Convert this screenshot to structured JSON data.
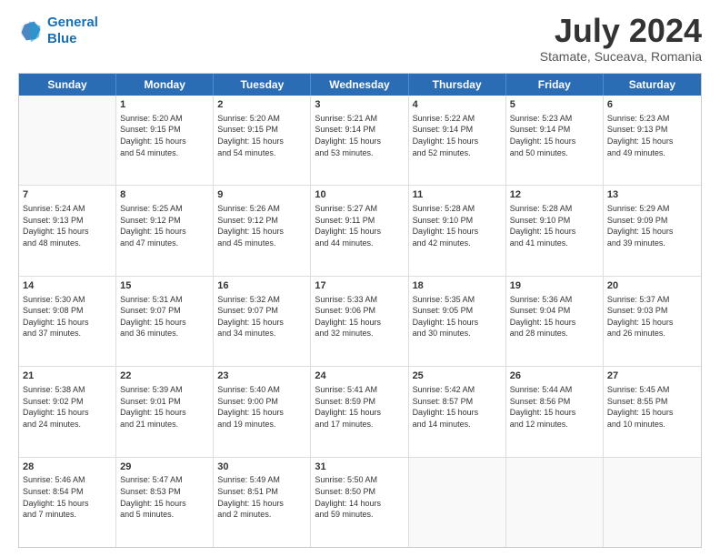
{
  "header": {
    "logo_line1": "General",
    "logo_line2": "Blue",
    "month_title": "July 2024",
    "location": "Stamate, Suceava, Romania"
  },
  "days_of_week": [
    "Sunday",
    "Monday",
    "Tuesday",
    "Wednesday",
    "Thursday",
    "Friday",
    "Saturday"
  ],
  "weeks": [
    [
      {
        "day": "",
        "content": ""
      },
      {
        "day": "1",
        "content": "Sunrise: 5:20 AM\nSunset: 9:15 PM\nDaylight: 15 hours\nand 54 minutes."
      },
      {
        "day": "2",
        "content": "Sunrise: 5:20 AM\nSunset: 9:15 PM\nDaylight: 15 hours\nand 54 minutes."
      },
      {
        "day": "3",
        "content": "Sunrise: 5:21 AM\nSunset: 9:14 PM\nDaylight: 15 hours\nand 53 minutes."
      },
      {
        "day": "4",
        "content": "Sunrise: 5:22 AM\nSunset: 9:14 PM\nDaylight: 15 hours\nand 52 minutes."
      },
      {
        "day": "5",
        "content": "Sunrise: 5:23 AM\nSunset: 9:14 PM\nDaylight: 15 hours\nand 50 minutes."
      },
      {
        "day": "6",
        "content": "Sunrise: 5:23 AM\nSunset: 9:13 PM\nDaylight: 15 hours\nand 49 minutes."
      }
    ],
    [
      {
        "day": "7",
        "content": "Sunrise: 5:24 AM\nSunset: 9:13 PM\nDaylight: 15 hours\nand 48 minutes."
      },
      {
        "day": "8",
        "content": "Sunrise: 5:25 AM\nSunset: 9:12 PM\nDaylight: 15 hours\nand 47 minutes."
      },
      {
        "day": "9",
        "content": "Sunrise: 5:26 AM\nSunset: 9:12 PM\nDaylight: 15 hours\nand 45 minutes."
      },
      {
        "day": "10",
        "content": "Sunrise: 5:27 AM\nSunset: 9:11 PM\nDaylight: 15 hours\nand 44 minutes."
      },
      {
        "day": "11",
        "content": "Sunrise: 5:28 AM\nSunset: 9:10 PM\nDaylight: 15 hours\nand 42 minutes."
      },
      {
        "day": "12",
        "content": "Sunrise: 5:28 AM\nSunset: 9:10 PM\nDaylight: 15 hours\nand 41 minutes."
      },
      {
        "day": "13",
        "content": "Sunrise: 5:29 AM\nSunset: 9:09 PM\nDaylight: 15 hours\nand 39 minutes."
      }
    ],
    [
      {
        "day": "14",
        "content": "Sunrise: 5:30 AM\nSunset: 9:08 PM\nDaylight: 15 hours\nand 37 minutes."
      },
      {
        "day": "15",
        "content": "Sunrise: 5:31 AM\nSunset: 9:07 PM\nDaylight: 15 hours\nand 36 minutes."
      },
      {
        "day": "16",
        "content": "Sunrise: 5:32 AM\nSunset: 9:07 PM\nDaylight: 15 hours\nand 34 minutes."
      },
      {
        "day": "17",
        "content": "Sunrise: 5:33 AM\nSunset: 9:06 PM\nDaylight: 15 hours\nand 32 minutes."
      },
      {
        "day": "18",
        "content": "Sunrise: 5:35 AM\nSunset: 9:05 PM\nDaylight: 15 hours\nand 30 minutes."
      },
      {
        "day": "19",
        "content": "Sunrise: 5:36 AM\nSunset: 9:04 PM\nDaylight: 15 hours\nand 28 minutes."
      },
      {
        "day": "20",
        "content": "Sunrise: 5:37 AM\nSunset: 9:03 PM\nDaylight: 15 hours\nand 26 minutes."
      }
    ],
    [
      {
        "day": "21",
        "content": "Sunrise: 5:38 AM\nSunset: 9:02 PM\nDaylight: 15 hours\nand 24 minutes."
      },
      {
        "day": "22",
        "content": "Sunrise: 5:39 AM\nSunset: 9:01 PM\nDaylight: 15 hours\nand 21 minutes."
      },
      {
        "day": "23",
        "content": "Sunrise: 5:40 AM\nSunset: 9:00 PM\nDaylight: 15 hours\nand 19 minutes."
      },
      {
        "day": "24",
        "content": "Sunrise: 5:41 AM\nSunset: 8:59 PM\nDaylight: 15 hours\nand 17 minutes."
      },
      {
        "day": "25",
        "content": "Sunrise: 5:42 AM\nSunset: 8:57 PM\nDaylight: 15 hours\nand 14 minutes."
      },
      {
        "day": "26",
        "content": "Sunrise: 5:44 AM\nSunset: 8:56 PM\nDaylight: 15 hours\nand 12 minutes."
      },
      {
        "day": "27",
        "content": "Sunrise: 5:45 AM\nSunset: 8:55 PM\nDaylight: 15 hours\nand 10 minutes."
      }
    ],
    [
      {
        "day": "28",
        "content": "Sunrise: 5:46 AM\nSunset: 8:54 PM\nDaylight: 15 hours\nand 7 minutes."
      },
      {
        "day": "29",
        "content": "Sunrise: 5:47 AM\nSunset: 8:53 PM\nDaylight: 15 hours\nand 5 minutes."
      },
      {
        "day": "30",
        "content": "Sunrise: 5:49 AM\nSunset: 8:51 PM\nDaylight: 15 hours\nand 2 minutes."
      },
      {
        "day": "31",
        "content": "Sunrise: 5:50 AM\nSunset: 8:50 PM\nDaylight: 14 hours\nand 59 minutes."
      },
      {
        "day": "",
        "content": ""
      },
      {
        "day": "",
        "content": ""
      },
      {
        "day": "",
        "content": ""
      }
    ]
  ]
}
